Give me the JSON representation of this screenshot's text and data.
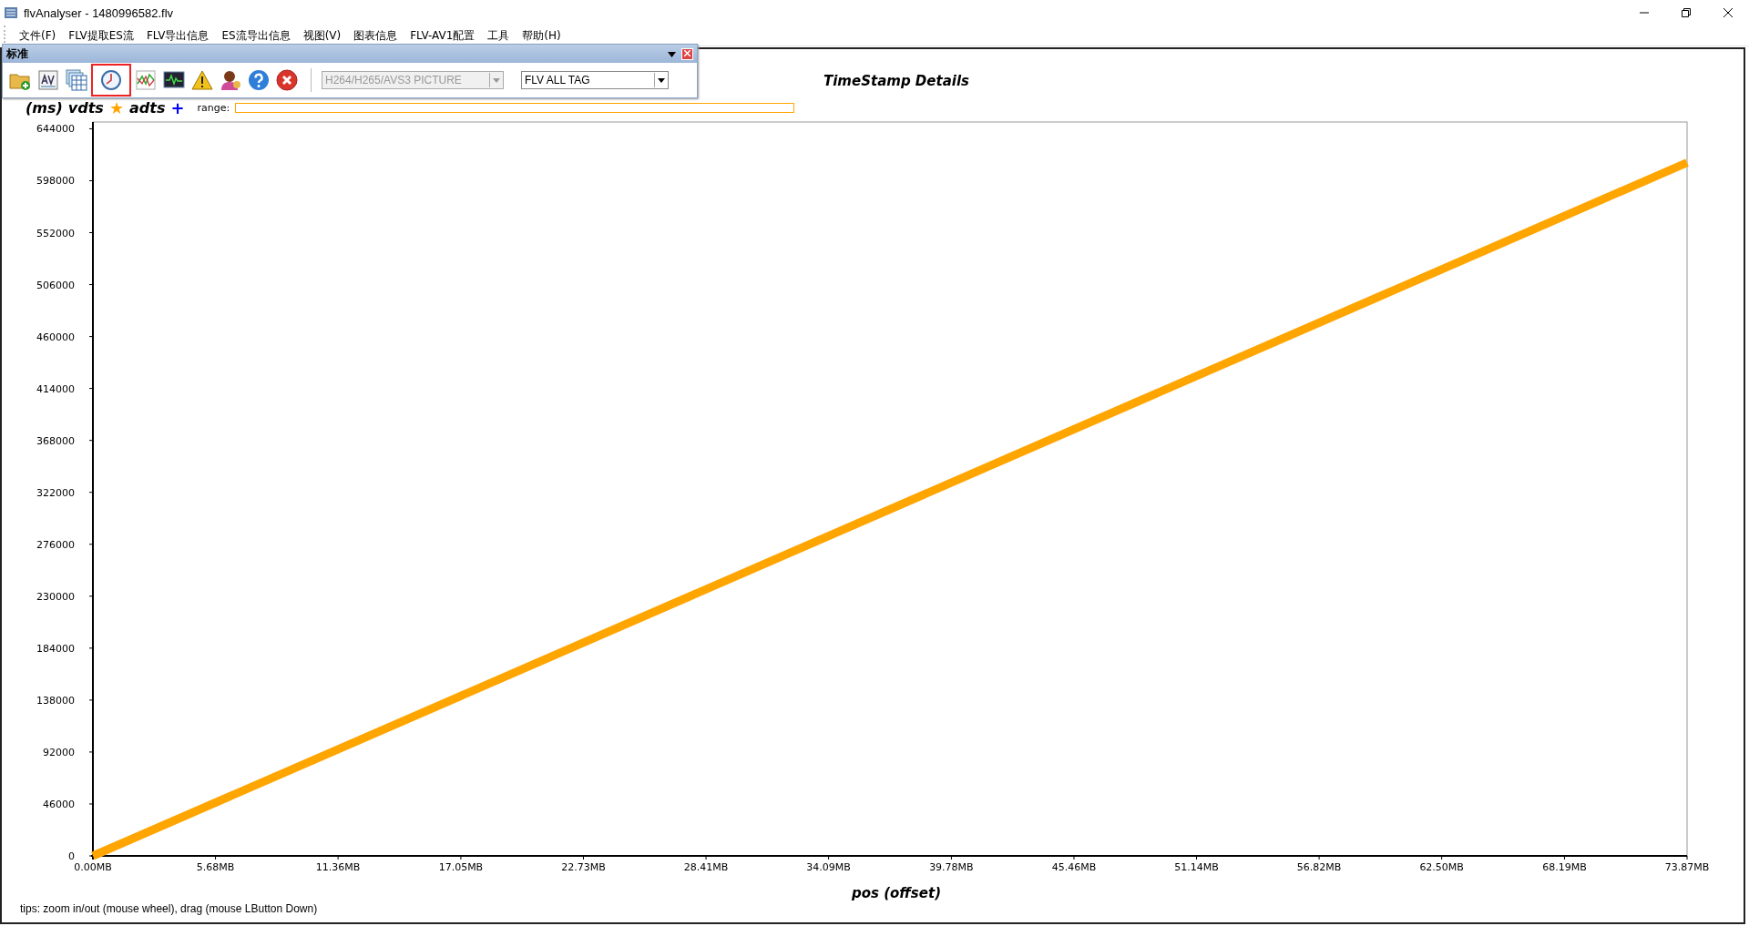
{
  "window": {
    "title": "flvAnalyser - 1480996582.flv"
  },
  "menu": [
    "文件(F)",
    "FLV提取ES流",
    "FLV导出信息",
    "ES流导出信息",
    "视图(V)",
    "图表信息",
    "FLV-AV1配置",
    "工具",
    "帮助(H)"
  ],
  "toolbar": {
    "title": "标准",
    "tools": [
      {
        "kind": "open",
        "selected": false
      },
      {
        "kind": "av",
        "selected": false
      },
      {
        "kind": "table",
        "selected": false
      },
      {
        "kind": "clock",
        "selected": true
      },
      {
        "kind": "linechart",
        "selected": false
      },
      {
        "kind": "monitor",
        "selected": false
      },
      {
        "kind": "warning",
        "selected": false
      },
      {
        "kind": "user",
        "selected": false
      },
      {
        "kind": "help",
        "selected": false
      },
      {
        "kind": "stop",
        "selected": false
      }
    ],
    "dropdowns": [
      {
        "value": "H264/H265/AVS3 PICTURE",
        "disabled": true
      },
      {
        "value": "FLV ALL TAG",
        "disabled": false
      }
    ]
  },
  "legend": {
    "markers": [
      "★",
      "+"
    ],
    "range_label": "range:"
  },
  "chart": {
    "chart_data": {
      "type": "line",
      "title": "TimeStamp Details",
      "xlabel": "pos (offset)",
      "ylabel": "(ms)",
      "x": [
        0,
        73.87
      ],
      "series": [
        {
          "name": "vdts",
          "color": "#ffa500",
          "values": [
            0,
            614000
          ]
        },
        {
          "name": "adts",
          "color": "#0000ff",
          "values": [
            null,
            null
          ]
        }
      ],
      "xlim": [
        0,
        73.87
      ],
      "ylim": [
        0,
        650000
      ],
      "xticks": [
        {
          "value": 0,
          "label": "0.00MB"
        },
        {
          "value": 5.68,
          "label": "5.68MB"
        },
        {
          "value": 11.36,
          "label": "11.36MB"
        },
        {
          "value": 17.05,
          "label": "17.05MB"
        },
        {
          "value": 22.73,
          "label": "22.73MB"
        },
        {
          "value": 28.41,
          "label": "28.41MB"
        },
        {
          "value": 34.09,
          "label": "34.09MB"
        },
        {
          "value": 39.78,
          "label": "39.78MB"
        },
        {
          "value": 45.46,
          "label": "45.46MB"
        },
        {
          "value": 51.14,
          "label": "51.14MB"
        },
        {
          "value": 56.82,
          "label": "56.82MB"
        },
        {
          "value": 62.5,
          "label": "62.50MB"
        },
        {
          "value": 68.19,
          "label": "68.19MB"
        },
        {
          "value": 73.87,
          "label": "73.87MB"
        }
      ],
      "yticks": [
        0,
        46000,
        92000,
        138000,
        184000,
        230000,
        276000,
        322000,
        368000,
        414000,
        460000,
        506000,
        552000,
        598000,
        644000
      ]
    }
  },
  "tips": "tips: zoom in/out (mouse wheel), drag (mouse LButton Down)"
}
